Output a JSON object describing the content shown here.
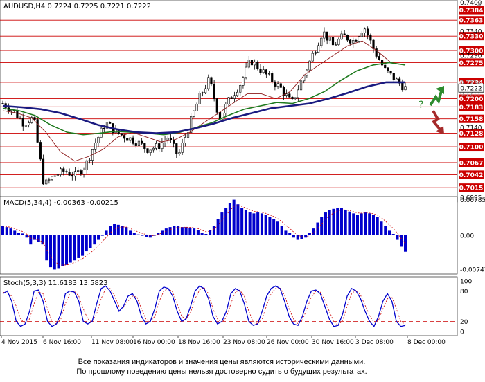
{
  "header": {
    "symbol_line": "AUDUSD,H4  0.7224 0.7225 0.7221 0.7222",
    "close_glyph": "✕"
  },
  "colors": {
    "background": "#ffffff",
    "level_line": "#cc0000",
    "level_label_bg": "#cc0000",
    "candle": "#000000",
    "ma_fast": "#8b1a1a",
    "ma_mid": "#1f7a1f",
    "ma_slow": "#1a1a80",
    "macd_hist": "#0000cc",
    "macd_signal": "#cc0000",
    "stoch_main": "#0000cc",
    "stoch_signal": "#cc0000",
    "arrow_up": "#2e8b2e",
    "arrow_down": "#a52a2a"
  },
  "chart_data": [
    {
      "type": "candlestick",
      "title": "AUDUSD,H4  0.7224 0.7225 0.7221 0.7222",
      "ylim": [
        0.6985,
        0.7405
      ],
      "current_price": "0.7222",
      "price_levels": [
        "0.7384",
        "0.7363",
        "0.7330",
        "0.7300",
        "0.7275",
        "0.7234",
        "0.7200",
        "0.7183",
        "0.7158",
        "0.7128",
        "0.7100",
        "0.7067",
        "0.7042",
        "0.7015"
      ],
      "scale_labels": [
        "0.7400",
        "0.7340",
        "0.7290",
        "0.7140",
        "0.6995"
      ],
      "faint_scale_labels": [
        "0.7234",
        "0.7220",
        "0.7211"
      ],
      "x_tick_labels": [
        "4 Nov 2015",
        "6 Nov 16:00",
        "11 Nov 08:00",
        "16 Nov 00:00",
        "18 Nov 16:00",
        "23 Nov 08:00",
        "26 Nov 00:00",
        "30 Nov 16:00",
        "3 Dec 08:00",
        "8 Dec 00:00"
      ],
      "annotations": [
        "?"
      ],
      "close_keypoints": [
        0.719,
        0.7175,
        0.715,
        0.716,
        0.702,
        0.704,
        0.705,
        0.704,
        0.706,
        0.711,
        0.715,
        0.713,
        0.712,
        0.711,
        0.7095,
        0.71,
        0.712,
        0.708,
        0.714,
        0.72,
        0.724,
        0.716,
        0.72,
        0.723,
        0.728,
        0.726,
        0.724,
        0.722,
        0.719,
        0.724,
        0.729,
        0.734,
        0.731,
        0.733,
        0.732,
        0.735,
        0.73,
        0.726,
        0.724,
        0.7222
      ],
      "series": [
        {
          "name": "",
          "values": [
            0.7175,
            0.717,
            0.716,
            0.713,
            0.709,
            0.707,
            0.708,
            0.7095,
            0.712,
            0.713,
            0.712,
            0.711,
            0.7115,
            0.713,
            0.715,
            0.717,
            0.719,
            0.721,
            0.721,
            0.72,
            0.7215,
            0.725,
            0.727,
            0.729,
            0.731,
            0.732,
            0.73,
            0.7275,
            0.727
          ]
        },
        {
          "name": "",
          "values": [
            0.718,
            0.7175,
            0.7165,
            0.7145,
            0.713,
            0.7125,
            0.7128,
            0.7132,
            0.713,
            0.7128,
            0.7125,
            0.713,
            0.714,
            0.715,
            0.7165,
            0.7178,
            0.7185,
            0.7192,
            0.719,
            0.72,
            0.7215,
            0.7238,
            0.7258,
            0.727,
            0.7275,
            0.727
          ]
        },
        {
          "name": "",
          "values": [
            0.7185,
            0.7182,
            0.7178,
            0.717,
            0.7158,
            0.7145,
            0.7136,
            0.713,
            0.7128,
            0.713,
            0.7138,
            0.7148,
            0.716,
            0.717,
            0.718,
            0.7185,
            0.719,
            0.72,
            0.7212,
            0.7225,
            0.7234,
            0.7234
          ]
        }
      ]
    },
    {
      "type": "bar",
      "title": "MACD(5,34,4) -0.00363 -0.00215",
      "ylim": [
        -0.0085,
        0.0085
      ],
      "scale_labels": [
        "0.00785",
        "0.00",
        "-0.00747"
      ],
      "values": [
        0.002,
        0.0018,
        0.0015,
        0.001,
        0.0006,
        0.0004,
        -0.0005,
        -0.002,
        -0.001,
        -0.0015,
        -0.002,
        -0.0055,
        -0.007,
        -0.0075,
        -0.0072,
        -0.0068,
        -0.0065,
        -0.006,
        -0.0055,
        -0.005,
        -0.0045,
        -0.0035,
        -0.0028,
        -0.002,
        -0.001,
        0.0,
        0.001,
        0.002,
        0.0025,
        0.0023,
        0.002,
        0.0018,
        0.001,
        0.0005,
        0.0002,
        0.0,
        -0.0003,
        -0.0005,
        0.0,
        0.0005,
        0.001,
        0.0015,
        0.0018,
        0.002,
        0.002,
        0.0018,
        0.0018,
        0.0017,
        0.0015,
        0.0012,
        0.0005,
        0.0003,
        0.0012,
        0.002,
        0.0035,
        0.005,
        0.006,
        0.007,
        0.0078,
        0.0068,
        0.006,
        0.0055,
        0.005,
        0.0048,
        0.005,
        0.0048,
        0.0045,
        0.004,
        0.0035,
        0.003,
        0.002,
        0.001,
        0.0005,
        -0.0005,
        -0.001,
        -0.0008,
        -0.0005,
        0.0005,
        0.0015,
        0.0028,
        0.004,
        0.005,
        0.0055,
        0.0058,
        0.006,
        0.006,
        0.0055,
        0.0052,
        0.0048,
        0.0045,
        0.0048,
        0.005,
        0.0048,
        0.0045,
        0.004,
        0.003,
        0.002,
        0.001,
        0.0003,
        -0.001,
        -0.0025,
        -0.0036
      ]
    },
    {
      "type": "line",
      "title": "Stoch(5,3,3) 11.6183 13.5823",
      "ylim": [
        0,
        100
      ],
      "scale_labels": [
        "100",
        "80",
        "20",
        "0"
      ],
      "reference_lines": [
        80,
        20
      ],
      "series": [
        {
          "name": "",
          "values": [
            75,
            80,
            60,
            20,
            10,
            15,
            40,
            80,
            82,
            60,
            20,
            10,
            15,
            35,
            75,
            80,
            78,
            60,
            20,
            15,
            20,
            55,
            85,
            90,
            80,
            60,
            40,
            50,
            70,
            75,
            60,
            30,
            15,
            20,
            45,
            80,
            88,
            85,
            70,
            40,
            20,
            25,
            50,
            80,
            90,
            85,
            65,
            30,
            15,
            20,
            40,
            75,
            85,
            80,
            55,
            20,
            12,
            15,
            40,
            70,
            85,
            90,
            85,
            60,
            30,
            15,
            12,
            30,
            60,
            80,
            82,
            75,
            50,
            25,
            10,
            12,
            35,
            70,
            85,
            80,
            65,
            40,
            20,
            10,
            30,
            60,
            75,
            60,
            20,
            10,
            12
          ]
        },
        {
          "name": "",
          "values": [
            78,
            76,
            70,
            50,
            25,
            15,
            25,
            55,
            78,
            75,
            45,
            20,
            15,
            25,
            55,
            75,
            80,
            70,
            45,
            25,
            20,
            35,
            65,
            85,
            85,
            70,
            50,
            48,
            60,
            70,
            68,
            45,
            25,
            20,
            30,
            60,
            80,
            85,
            78,
            55,
            30,
            25,
            38,
            65,
            82,
            87,
            75,
            45,
            25,
            18,
            28,
            55,
            78,
            82,
            70,
            40,
            20,
            15,
            25,
            52,
            75,
            85,
            87,
            72,
            45,
            25,
            15,
            22,
            45,
            68,
            80,
            78,
            62,
            40,
            20,
            12,
            22,
            50,
            75,
            82,
            72,
            52,
            32,
            18,
            22,
            45,
            65,
            68,
            45,
            20,
            14
          ]
        }
      ]
    }
  ],
  "disclaimer": {
    "line1": "Все показания индикаторов и значения цены являются историческими данными.",
    "line2": "По прошлому поведению цены нельзя достоверно судить о будущих результатах."
  }
}
